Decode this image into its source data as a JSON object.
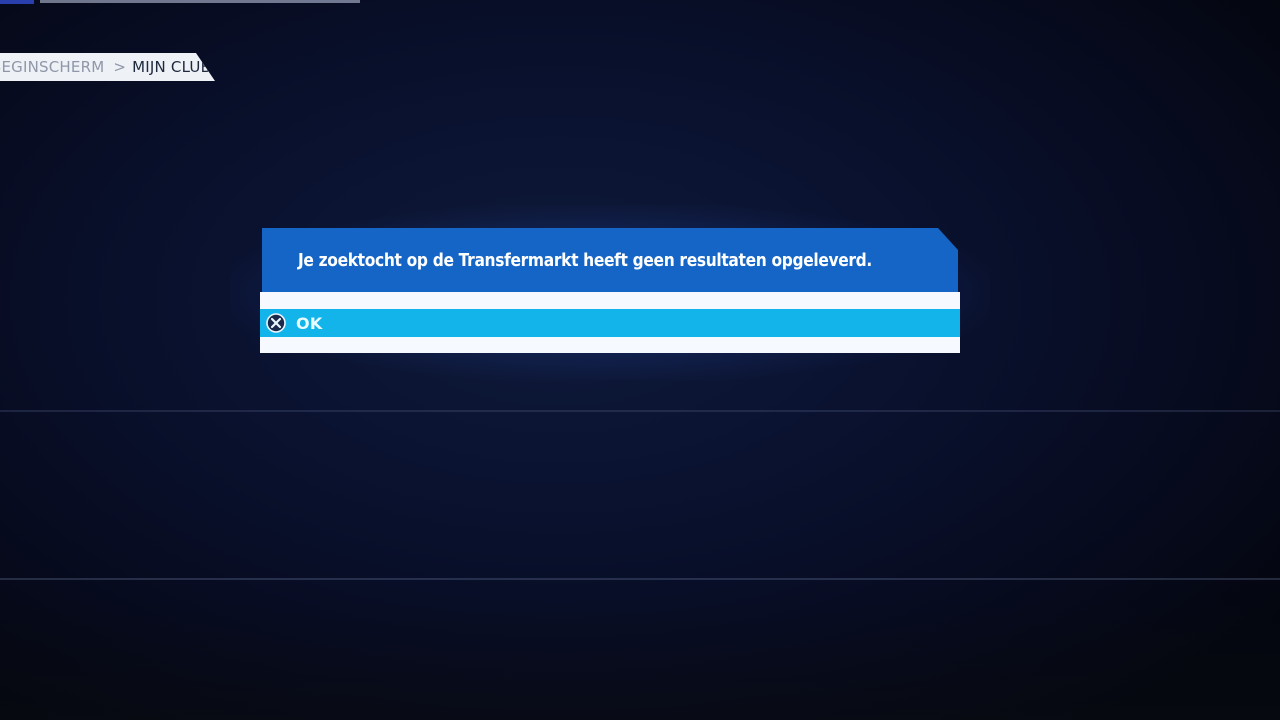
{
  "breadcrumb": {
    "previous": "BEGINSCHERM",
    "separator": ">",
    "current": "MIJN CLUB"
  },
  "dialog": {
    "message": "Je zoektocht op de Transfermarkt heeft geen resultaten opgeleverd.",
    "options": [
      {
        "label": "OK",
        "button_icon": "cross-button-icon",
        "selected": true
      }
    ]
  },
  "colors": {
    "background": "#0a1230",
    "dialog_header": "#1565c6",
    "dialog_body": "#f6f9ff",
    "selected_option": "#12b4ea",
    "breadcrumb_bg": "#eef1f6"
  }
}
